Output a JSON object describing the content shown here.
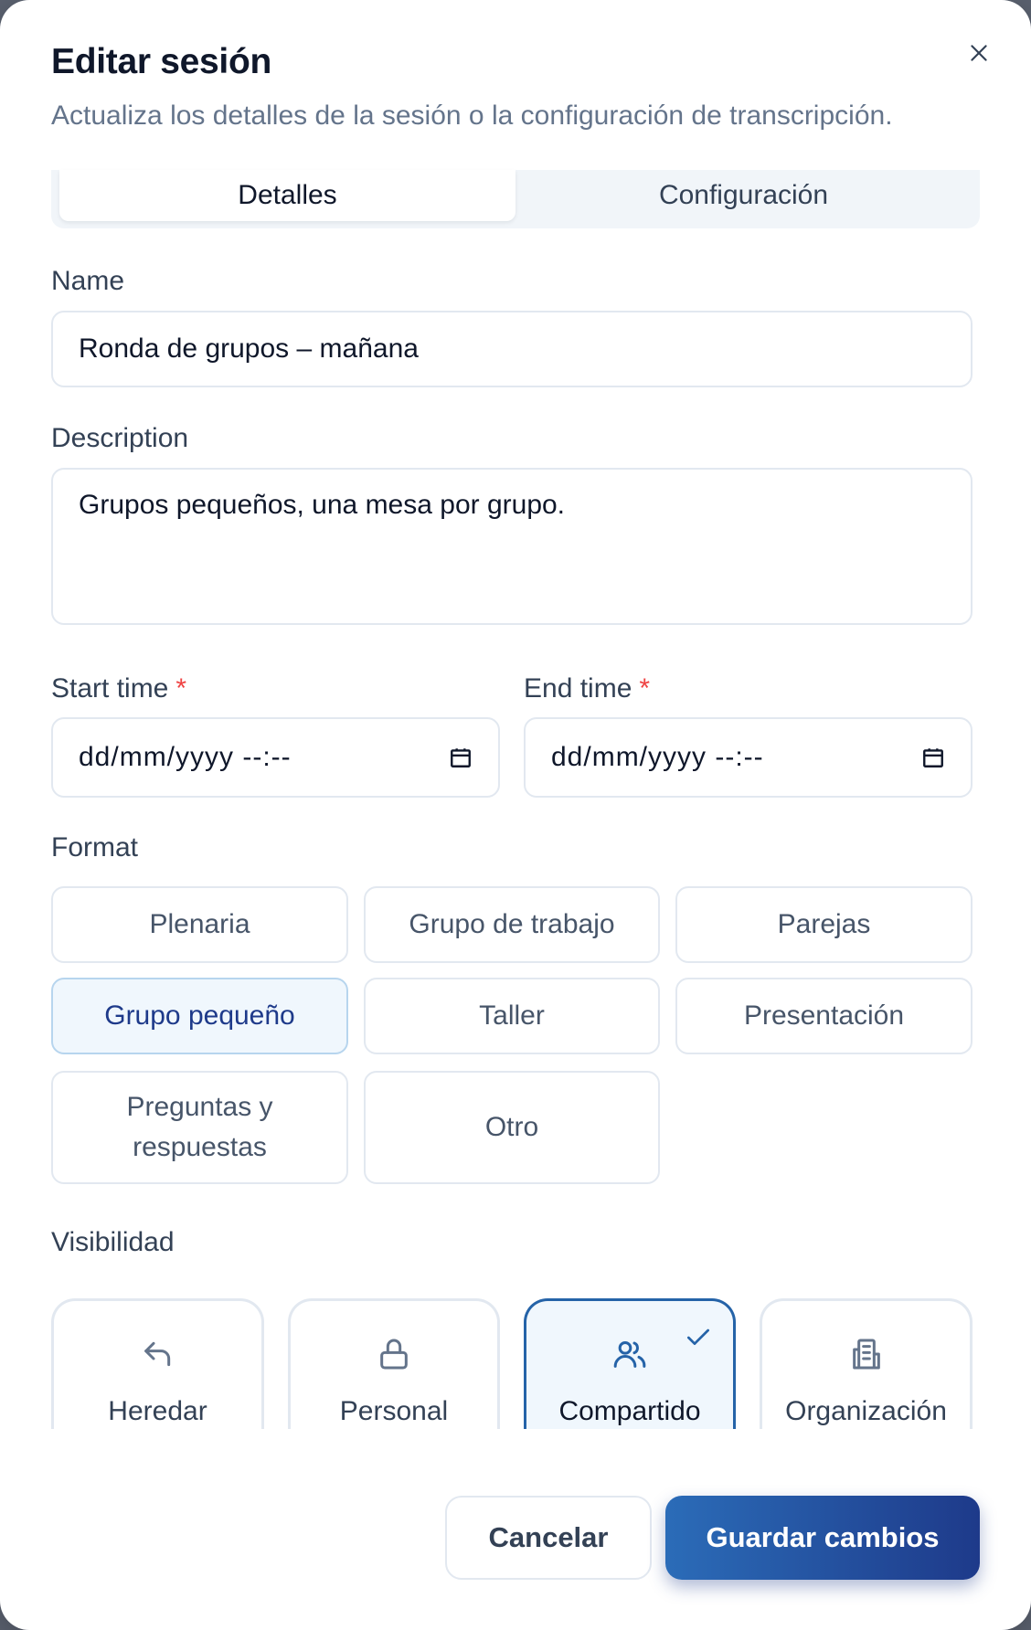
{
  "dialog": {
    "title": "Editar sesión",
    "subtitle": "Actualiza los detalles de la sesión o la configuración de transcripción.",
    "close_icon": "close-icon"
  },
  "tabs": [
    {
      "label": "Detalles",
      "active": true
    },
    {
      "label": "Configuración",
      "active": false
    }
  ],
  "form": {
    "name": {
      "label": "Name",
      "value": "Ronda de grupos – mañana"
    },
    "description": {
      "label": "Description",
      "value": "Grupos pequeños, una mesa por grupo."
    },
    "start_time": {
      "label": "Start time",
      "required_mark": "*",
      "placeholder": "dd/mm/yyyy --:--"
    },
    "end_time": {
      "label": "End time",
      "required_mark": "*",
      "placeholder": "dd/mm/yyyy --:--"
    },
    "format": {
      "label": "Format",
      "options": [
        "Plenaria",
        "Grupo de trabajo",
        "Parejas",
        "Grupo pequeño",
        "Taller",
        "Presentación",
        "Preguntas y respuestas",
        "Otro"
      ],
      "selected": "Grupo pequeño"
    },
    "visibility": {
      "label": "Visibilidad",
      "options": [
        {
          "label": "Heredar",
          "icon": "undo-arrow-icon"
        },
        {
          "label": "Personal",
          "icon": "lock-icon"
        },
        {
          "label": "Compartido",
          "icon": "users-icon"
        },
        {
          "label": "Organización",
          "icon": "building-icon"
        }
      ],
      "selected": "Compartido"
    }
  },
  "footer": {
    "cancel_label": "Cancelar",
    "save_label": "Guardar cambios"
  },
  "colors": {
    "accent": "#2563a8",
    "required": "#ef4444",
    "selected_bg": "#f0f7fd"
  }
}
